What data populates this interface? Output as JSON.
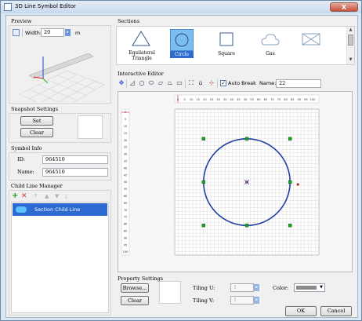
{
  "window": {
    "title": "3D Line Symbol Editor",
    "close": "X"
  },
  "preview": {
    "label": "Preview",
    "width_label": "Width:",
    "width_value": "20",
    "unit": "m"
  },
  "snapshot": {
    "label": "Snapshot Settings",
    "set": "Set",
    "clear": "Clear"
  },
  "symbol_info": {
    "label": "Symbol Info",
    "id_label": "ID:",
    "id_value": "964510",
    "name_label": "Name:",
    "name_value": "964510"
  },
  "child_line": {
    "label": "Child Line Manager",
    "items": [
      "Section Child Line"
    ]
  },
  "sections": {
    "label": "Sections",
    "items": [
      {
        "label": "Equilateral Triangle",
        "selected": false
      },
      {
        "label": "Circle",
        "selected": true
      },
      {
        "label": "Square",
        "selected": false
      },
      {
        "label": "Gas",
        "selected": false
      },
      {
        "label": "",
        "selected": false
      }
    ]
  },
  "editor": {
    "label": "Interactive Editor",
    "auto_break_label": "Auto Break",
    "auto_break": true,
    "name_label": "Name:",
    "name_value": "22",
    "ruler_top": [
      "0",
      "5",
      "10",
      "15",
      "20",
      "25",
      "30",
      "35",
      "40",
      "45",
      "50",
      "55",
      "60",
      "65",
      "70",
      "75",
      "80",
      "85",
      "90",
      "95",
      "100"
    ],
    "ruler_left": [
      "0",
      "5",
      "10",
      "15",
      "20",
      "25",
      "30",
      "35",
      "40",
      "45",
      "50",
      "55",
      "60",
      "65",
      "70",
      "75",
      "80",
      "85",
      "90",
      "95",
      "100"
    ]
  },
  "property": {
    "label": "Property Settings",
    "browse": "Browse...",
    "clear": "Clear",
    "tiling_u_label": "Tiling U:",
    "tiling_u_value": "1",
    "tiling_v_label": "Tiling V:",
    "tiling_v_value": "1",
    "color_label": "Color:"
  },
  "footer": {
    "ok": "OK",
    "cancel": "Cancel"
  },
  "colors": {
    "accent": "#3a6fd1",
    "circle": "#1f3fa6",
    "selection": "#2d6ad1"
  }
}
